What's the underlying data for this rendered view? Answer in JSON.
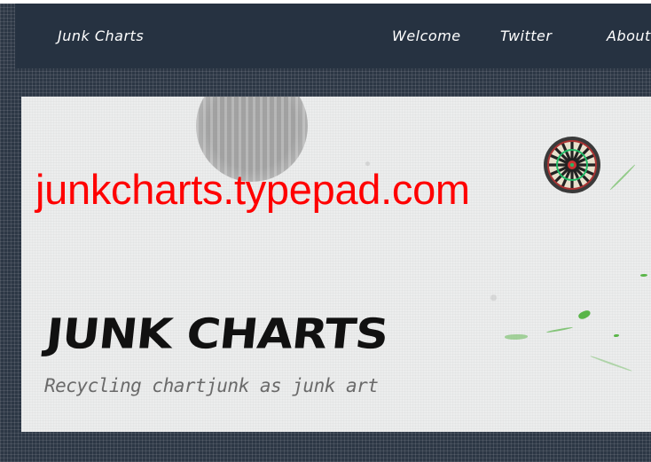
{
  "nav": {
    "brand": "Junk Charts",
    "links": [
      {
        "label": "Welcome"
      },
      {
        "label": "Twitter"
      },
      {
        "label": "About"
      }
    ]
  },
  "banner": {
    "url_overlay": "junkcharts.typepad.com",
    "title": "JUNK CHARTS",
    "tagline": "Recycling chartjunk as junk art"
  },
  "colors": {
    "navbar": "#263241",
    "background": "#2c3745",
    "overlay_text": "#ff0000",
    "splat": "#59b548"
  }
}
